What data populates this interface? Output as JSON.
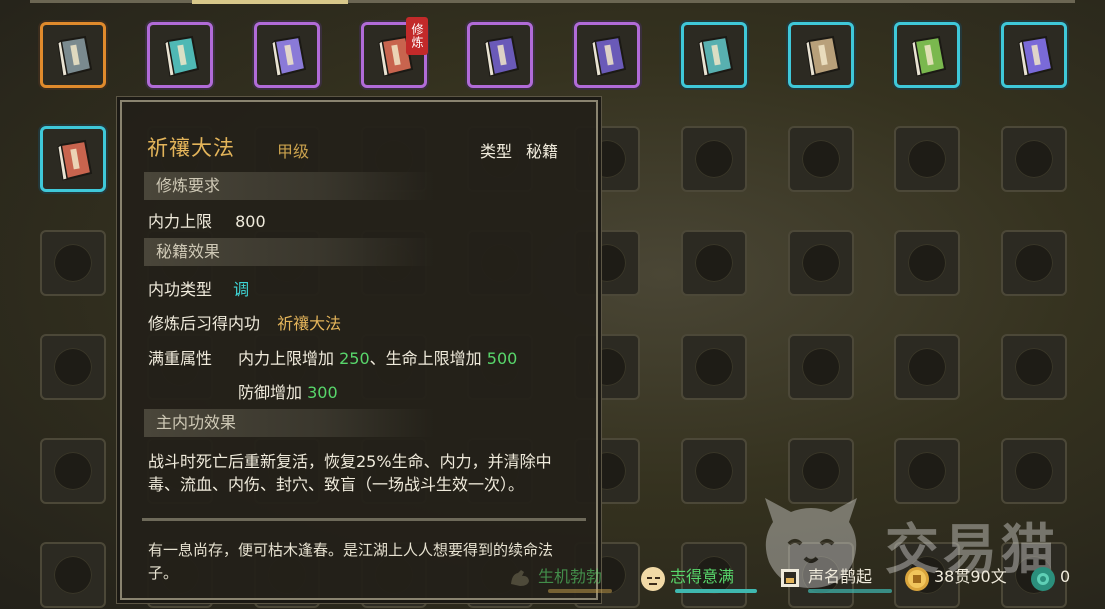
{
  "inventory": {
    "badge_text": "修炼",
    "books": [
      {
        "color": "#7a8a8f",
        "frame": "orange"
      },
      {
        "color": "#4fb8b4",
        "frame": "purple"
      },
      {
        "color": "#8a7ad8",
        "frame": "purple"
      },
      {
        "color": "#c8644e",
        "frame": "purple"
      },
      {
        "color": "#6a5ab8",
        "frame": "purple"
      },
      {
        "color": "#6a5ab8",
        "frame": "purple"
      },
      {
        "color": "#58b0b0",
        "frame": "cyan"
      },
      {
        "color": "#b8a07a",
        "frame": "cyan"
      },
      {
        "color": "#7ab84e",
        "frame": "cyan"
      },
      {
        "color": "#7a6ad8",
        "frame": "cyan"
      },
      {
        "color": "#c8644e",
        "frame": "cyan"
      }
    ]
  },
  "tooltip": {
    "title": "祈禳大法",
    "grade": "甲级",
    "type_label": "类型",
    "type_value": "秘籍",
    "section_requirements": "修炼要求",
    "req_label": "内力上限",
    "req_value": "800",
    "section_effects": "秘籍效果",
    "inner_type_label": "内功类型",
    "inner_type_value": "调",
    "learn_label": "修炼后习得内功",
    "learn_value": "祈禳大法",
    "full_label": "满重属性",
    "full_attr1_name": "内力上限增加",
    "full_attr1_value": "250",
    "full_attr1_sep": "、",
    "full_attr2_name": "生命上限增加",
    "full_attr2_value": "500",
    "full_attr3_name": "防御增加",
    "full_attr3_value": "300",
    "section_main": "主内功效果",
    "main_effect": "战斗时死亡后重新复活，恢复25%生命、内力，并清除中毒、流血、内伤、封穴、致盲（一场战斗生效一次）。",
    "flavor": "有一息尚存，便可枯木逢春。是江湖上人人想要得到的续命法子。"
  },
  "status_bar": {
    "vitality": "生机勃勃",
    "mood": "志得意满",
    "fame": "声名鹊起",
    "money": "38贯90文",
    "jade": "0"
  },
  "colors": {
    "vitality_bar": "#3fa6a6",
    "mood_bar": "#3fb8b0",
    "fame_bar": "#3fb8b0",
    "status_green": "#58d66b"
  },
  "watermark": {
    "text": "交易猫"
  }
}
